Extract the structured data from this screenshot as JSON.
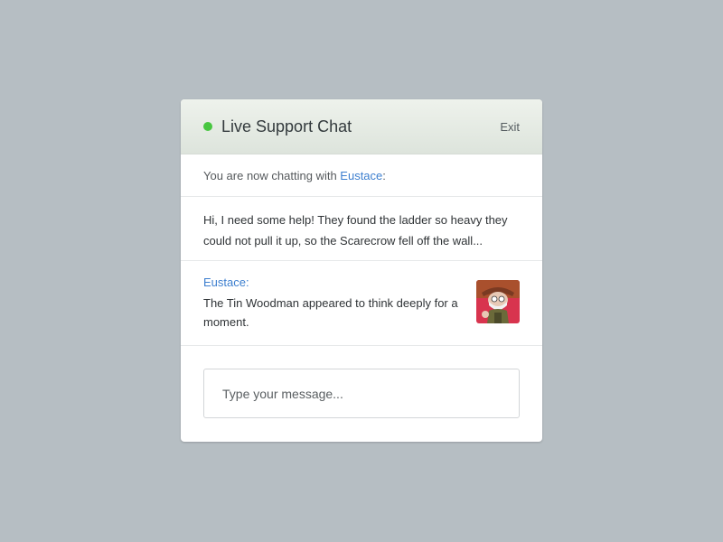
{
  "header": {
    "title": "Live Support Chat",
    "exit_label": "Exit",
    "status_color": "#47c640"
  },
  "system_notice": {
    "prefix": "You are now chatting with ",
    "agent_name": "Eustace",
    "suffix": ":"
  },
  "messages": [
    {
      "sender": "user",
      "text": "Hi, I need some help! They found the ladder so heavy they could not pull it up, so the Scarecrow fell off the wall..."
    },
    {
      "sender": "agent",
      "name": "Eustace:",
      "text": "The Tin Woodman appeared to think deeply for a moment.",
      "avatar_icon": "agent-avatar-image"
    }
  ],
  "composer": {
    "placeholder": "Type your message...",
    "value": ""
  }
}
